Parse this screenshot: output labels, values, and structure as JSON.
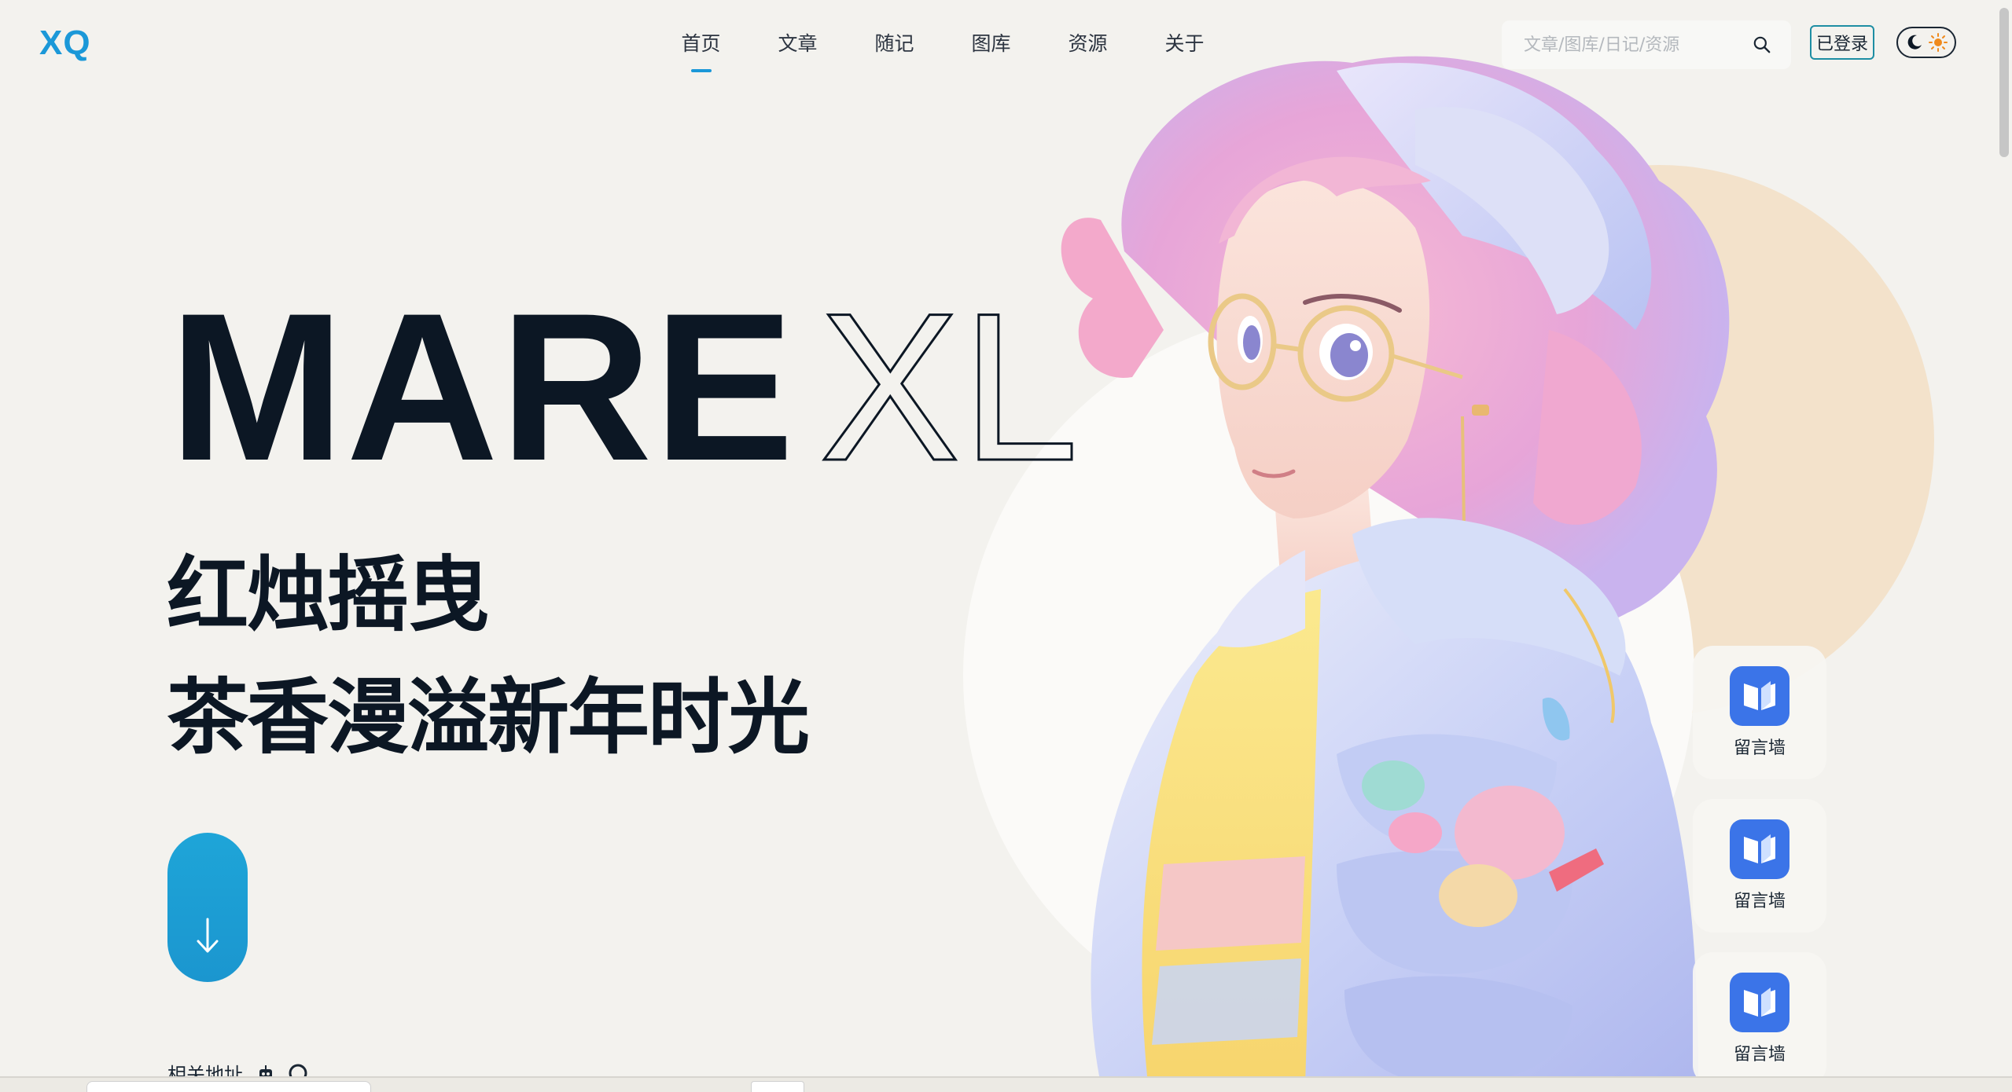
{
  "brand": {
    "logo": "XQ",
    "accent_color": "#1b98d8"
  },
  "nav": {
    "items": [
      {
        "label": "首页",
        "active": true
      },
      {
        "label": "文章",
        "active": false
      },
      {
        "label": "随记",
        "active": false
      },
      {
        "label": "图库",
        "active": false
      },
      {
        "label": "资源",
        "active": false
      },
      {
        "label": "关于",
        "active": false
      }
    ]
  },
  "search": {
    "placeholder": "文章/图库/日记/资源",
    "icon": "search-icon"
  },
  "auth": {
    "login_label": "已登录"
  },
  "theme": {
    "moon_icon": "moon-icon",
    "sun_icon": "sun-icon"
  },
  "hero": {
    "title_solid": "MARE",
    "title_outline": "XL",
    "line1": "红烛摇曳",
    "line2": "茶香漫溢新年时光",
    "scroll_icon": "arrow-down-icon",
    "button_color": "#1ea5d8"
  },
  "related": {
    "label": "相关地址",
    "icons": [
      "robot-icon",
      "github-icon"
    ]
  },
  "side_cards": [
    {
      "label": "留言墙",
      "icon": "book-icon"
    },
    {
      "label": "留言墙",
      "icon": "book-icon"
    },
    {
      "label": "留言墙",
      "icon": "book-icon"
    }
  ]
}
